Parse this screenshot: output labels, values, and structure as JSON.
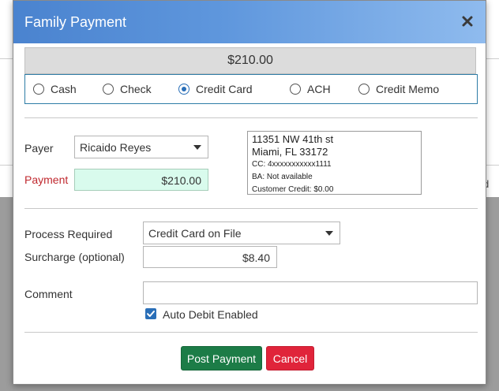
{
  "background": {
    "fragment": "d"
  },
  "dialog": {
    "title": "Family Payment",
    "close_icon": "close-icon",
    "amount": "$210.00",
    "payment_methods": [
      {
        "label": "Cash",
        "selected": false
      },
      {
        "label": "Check",
        "selected": false
      },
      {
        "label": "Credit Card",
        "selected": true
      },
      {
        "label": "ACH",
        "selected": false
      },
      {
        "label": "Credit Memo",
        "selected": false
      }
    ],
    "payer": {
      "label": "Payer",
      "value": "Ricaido Reyes"
    },
    "payment": {
      "label": "Payment",
      "value": "$210.00"
    },
    "address": {
      "line1": "11351 NW 41th st",
      "line2": "Miami, FL 33172",
      "cc": "CC: 4xxxxxxxxxxx1111",
      "ba": "BA: Not available",
      "customer_credit": "Customer Credit: $0.00"
    },
    "process_required": {
      "label": "Process Required",
      "value": "Credit Card on File"
    },
    "surcharge": {
      "label": "Surcharge (optional)",
      "value": "$8.40"
    },
    "comment": {
      "label": "Comment",
      "value": ""
    },
    "auto_debit": {
      "label": "Auto Debit Enabled",
      "checked": true
    },
    "buttons": {
      "post": "Post Payment",
      "cancel": "Cancel"
    }
  },
  "colors": {
    "header": "#5b93dc",
    "selected_radio": "#2a6fb8",
    "payment_field": "#d9fbed",
    "post_button": "#1c7c47",
    "cancel_button": "#e0243a",
    "required_label": "#c0292f"
  }
}
